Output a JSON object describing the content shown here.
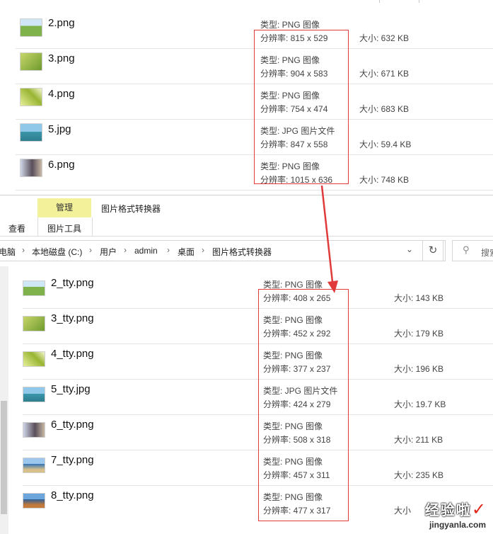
{
  "top_window": {
    "files": [
      {
        "name": "2.png",
        "type": "类型: PNG 图像",
        "resolution": "分辨率: 815 x 529",
        "size": "大小: 632 KB",
        "thumb_color": "#7fb24a"
      },
      {
        "name": "3.png",
        "type": "类型: PNG 图像",
        "resolution": "分辨率: 904 x 583",
        "size": "大小: 671 KB",
        "thumb_color": "#8fae3c"
      },
      {
        "name": "4.png",
        "type": "类型: PNG 图像",
        "resolution": "分辨率: 754 x 474",
        "size": "大小: 683 KB",
        "thumb_color": "#b7c640"
      },
      {
        "name": "5.jpg",
        "type": "类型: JPG 图片文件",
        "resolution": "分辨率: 847 x 558",
        "size": "大小: 59.4 KB",
        "thumb_color": "#4d9fb8"
      },
      {
        "name": "6.png",
        "type": "类型: PNG 图像",
        "resolution": "分辨率: 1015 x 636",
        "size": "大小: 748 KB",
        "thumb_color": "#6f6d8a"
      }
    ]
  },
  "ribbon": {
    "context_tab": "管理",
    "context_tab_title": "图片格式转换器",
    "tab_view": "查看",
    "tab_picture_tools": "图片工具"
  },
  "address": {
    "crumbs": [
      "电脑",
      "本地磁盘 (C:)",
      "用户",
      "admin",
      "桌面",
      "图片格式转换器"
    ],
    "search_placeholder": "搜索"
  },
  "bottom_window": {
    "files": [
      {
        "name": "2_tty.png",
        "type": "类型: PNG 图像",
        "resolution": "分辨率: 408 x 265",
        "size": "大小: 143 KB",
        "thumb_color": "#7fb24a"
      },
      {
        "name": "3_tty.png",
        "type": "类型: PNG 图像",
        "resolution": "分辨率: 452 x 292",
        "size": "大小: 179 KB",
        "thumb_color": "#8fae3c"
      },
      {
        "name": "4_tty.png",
        "type": "类型: PNG 图像",
        "resolution": "分辨率: 377 x 237",
        "size": "大小: 196 KB",
        "thumb_color": "#b7c640"
      },
      {
        "name": "5_tty.jpg",
        "type": "类型: JPG 图片文件",
        "resolution": "分辨率: 424 x 279",
        "size": "大小: 19.7 KB",
        "thumb_color": "#4d9fb8"
      },
      {
        "name": "6_tty.png",
        "type": "类型: PNG 图像",
        "resolution": "分辨率: 508 x 318",
        "size": "大小: 211 KB",
        "thumb_color": "#6f6d8a"
      },
      {
        "name": "7_tty.png",
        "type": "类型: PNG 图像",
        "resolution": "分辨率: 457 x 311",
        "size": "大小: 235 KB",
        "thumb_color": "#3f86c8"
      },
      {
        "name": "8_tty.png",
        "type": "类型: PNG 图像",
        "resolution": "分辨率: 477 x 317",
        "size": "大小",
        "thumb_color": "#3b6fb0"
      }
    ]
  },
  "watermark": {
    "cn": "经验啦",
    "en": "jingyanla.com",
    "check": "✓"
  },
  "colors": {
    "highlight_box": "#e03a3a",
    "context_tab_bg": "#f3f19a"
  }
}
